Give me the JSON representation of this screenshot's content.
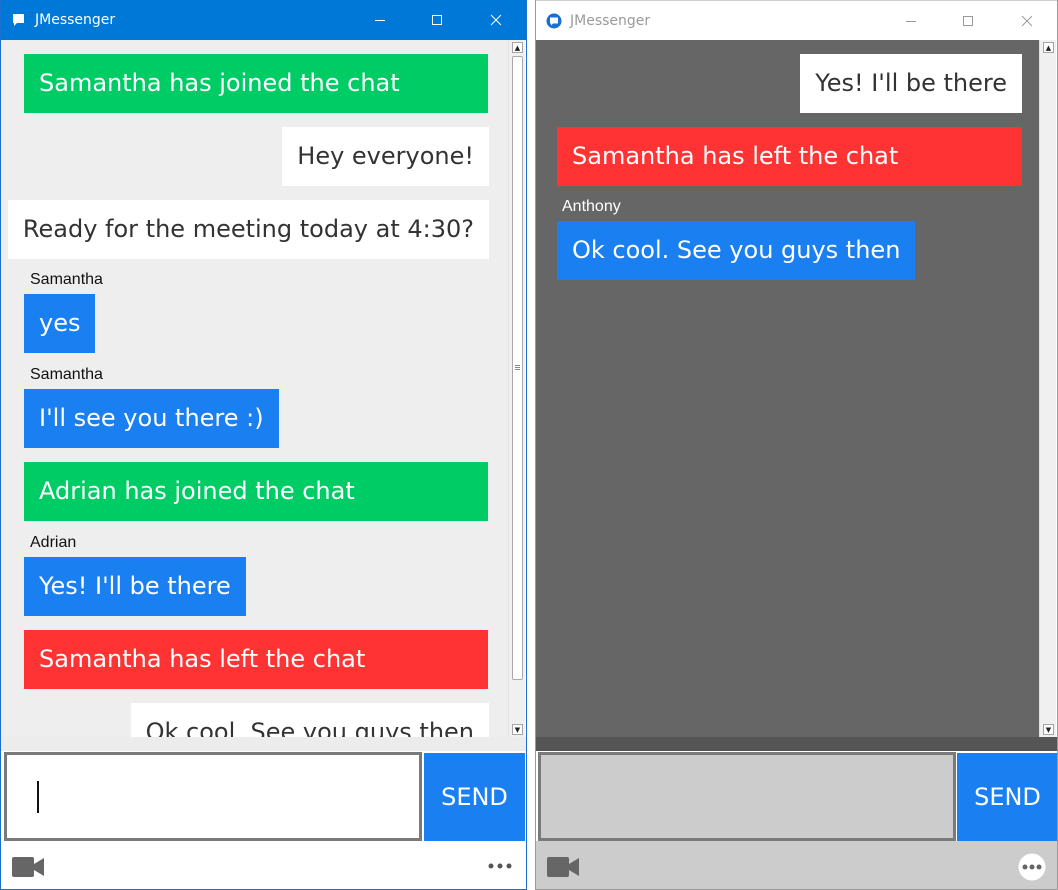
{
  "window_left": {
    "title": "JMessenger",
    "messages": [
      {
        "kind": "join",
        "text": "Samantha has joined the chat"
      },
      {
        "kind": "mine",
        "text": "Hey everyone!"
      },
      {
        "kind": "mine",
        "text": "Ready for the meeting today at 4:30?"
      },
      {
        "kind": "other",
        "sender": "Samantha",
        "text": "yes"
      },
      {
        "kind": "other",
        "sender": "Samantha",
        "text": "I'll see you there :)"
      },
      {
        "kind": "join",
        "text": "Adrian has joined the chat"
      },
      {
        "kind": "other",
        "sender": "Adrian",
        "text": "Yes! I'll be there"
      },
      {
        "kind": "left",
        "text": "Samantha has left the chat"
      },
      {
        "kind": "mine",
        "text": "Ok cool. See you guys then"
      }
    ],
    "input_value": "",
    "send_label": "SEND"
  },
  "window_right": {
    "title": "JMessenger",
    "messages": [
      {
        "kind": "mine",
        "text": "Yes! I'll be there"
      },
      {
        "kind": "left",
        "text": "Samantha has left the chat"
      },
      {
        "kind": "other",
        "sender": "Anthony",
        "text": "Ok cool. See you guys then"
      }
    ],
    "input_value": "",
    "send_label": "SEND"
  },
  "icons": {
    "app": "chat-bubble-icon",
    "minimize": "minimize-icon",
    "maximize": "maximize-icon",
    "close": "close-icon",
    "video": "video-camera-icon",
    "more": "more-options-icon"
  },
  "colors": {
    "join": "#00cc66",
    "left": "#ff3333",
    "other": "#1a7ff0",
    "mine": "#ffffff",
    "send": "#1a7ff0",
    "titlebar_active": "#0078d7",
    "chat_bg_left": "#eeeeee",
    "chat_bg_right": "#666666"
  }
}
